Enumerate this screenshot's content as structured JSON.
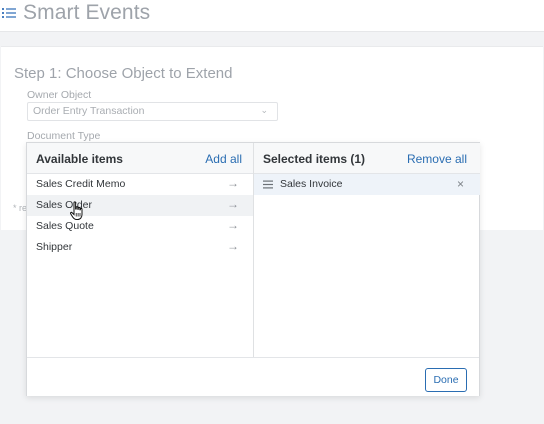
{
  "app": {
    "title": "Smart Events"
  },
  "form": {
    "step_title": "Step 1: Choose Object to Extend",
    "owner_object_label": "Owner Object",
    "owner_object_value": "Order Entry Transaction",
    "document_type_label": "Document Type",
    "required_note": "* re"
  },
  "dialog": {
    "available": {
      "title": "Available items",
      "action": "Add all",
      "items": [
        {
          "label": "Sales Credit Memo"
        },
        {
          "label": "Sales Order"
        },
        {
          "label": "Sales Quote"
        },
        {
          "label": "Shipper"
        }
      ]
    },
    "selected": {
      "title": "Selected items (1)",
      "action": "Remove all",
      "items": [
        {
          "label": "Sales Invoice"
        }
      ]
    },
    "done_label": "Done"
  },
  "icons": {
    "menu": "menu-icon",
    "arrow": "arrow-right-icon",
    "drag": "drag-handle-icon",
    "remove": "close-icon",
    "dropdown": "chevron-down-icon",
    "cursor": "hand-pointer-icon"
  },
  "colors": {
    "accent": "#2a6db2",
    "text": "#32363a",
    "muted": "#9ea3aa",
    "selected_bg": "#eef3f9"
  }
}
